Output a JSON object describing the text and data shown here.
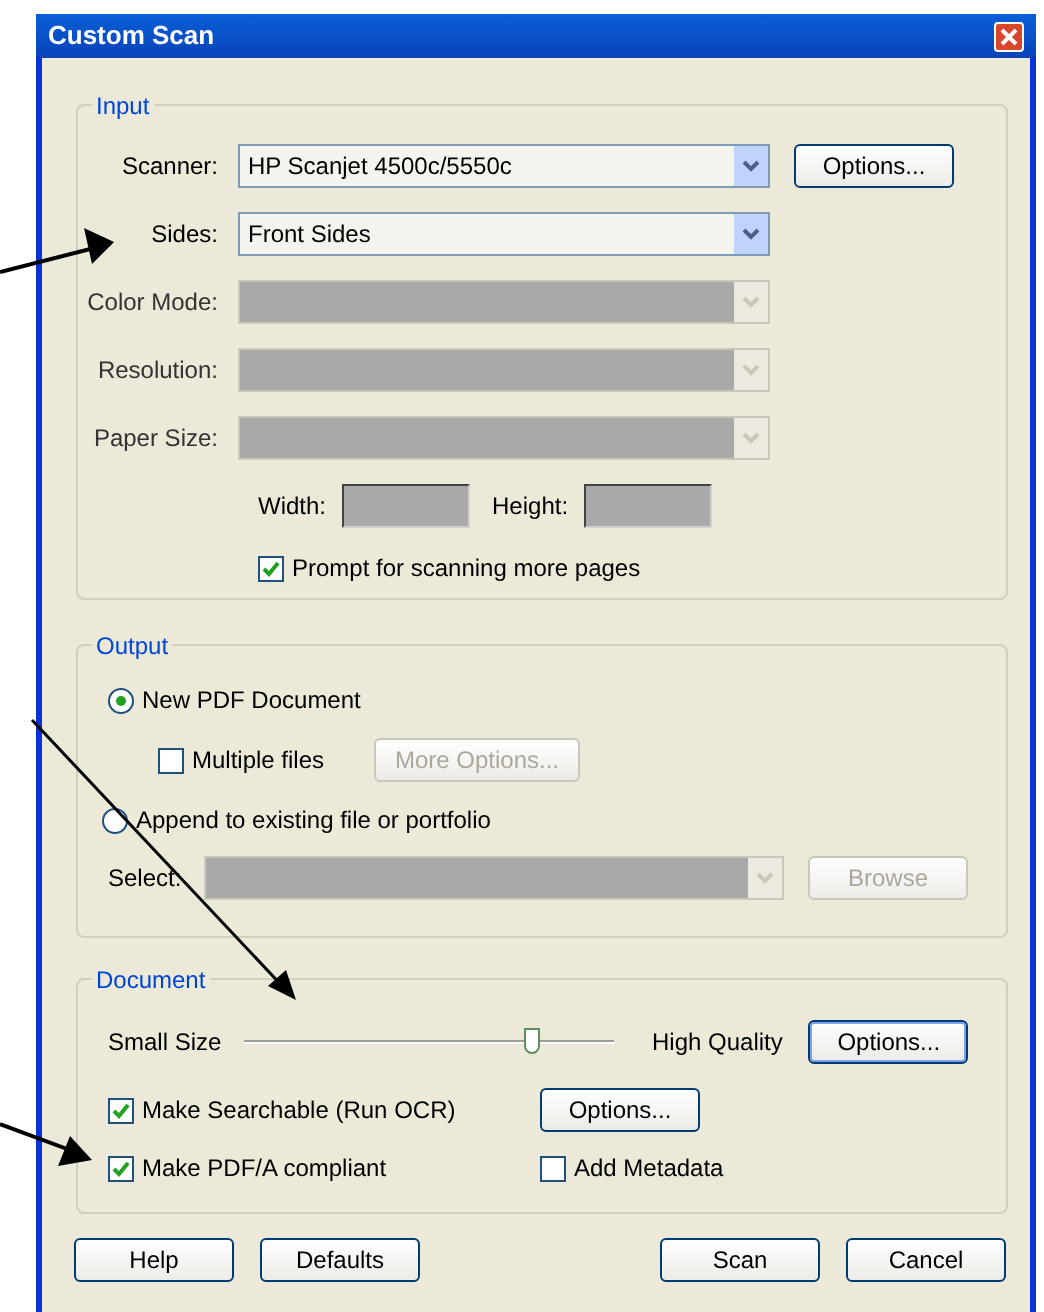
{
  "window": {
    "title": "Custom Scan"
  },
  "input": {
    "legend": "Input",
    "fields": [
      {
        "label": "Scanner:",
        "value": "HP Scanjet 4500c/5550c",
        "disabled": false,
        "button": "Options..."
      },
      {
        "label": "Sides:",
        "value": "Front Sides",
        "disabled": false
      },
      {
        "label": "Color Mode:",
        "disabled": true
      },
      {
        "label": "Resolution:",
        "disabled": true
      },
      {
        "label": "Paper Size:",
        "disabled": true
      }
    ],
    "size": [
      {
        "label": "Width:",
        "disabled": true
      },
      {
        "label": "Height:",
        "disabled": true
      }
    ],
    "prompt": {
      "label": "Prompt for scanning more pages",
      "checked": true
    }
  },
  "output": {
    "legend": "Output",
    "new_pdf": {
      "label": "New PDF Document",
      "selected": true
    },
    "multiple_files": {
      "label": "Multiple files",
      "checked": false
    },
    "more_options": {
      "label": "More Options...",
      "disabled": true
    },
    "append": {
      "label": "Append to existing file or portfolio",
      "selected": false
    },
    "select": {
      "label": "Select:",
      "disabled": true
    },
    "browse": {
      "label": "Browse",
      "disabled": true
    }
  },
  "document": {
    "legend": "Document",
    "min_label": "Small Size",
    "max_label": "High Quality",
    "level": 0.78,
    "options": "Options...",
    "searchable": {
      "label": "Make Searchable (Run OCR)",
      "checked": true,
      "button": "Options..."
    },
    "pdfa": {
      "label": "Make PDF/A compliant",
      "checked": true
    },
    "metadata": {
      "label": "Add Metadata",
      "checked": false
    }
  },
  "left_buttons": [
    "Help",
    "Defaults"
  ],
  "right_buttons": [
    "Scan",
    "Cancel"
  ]
}
